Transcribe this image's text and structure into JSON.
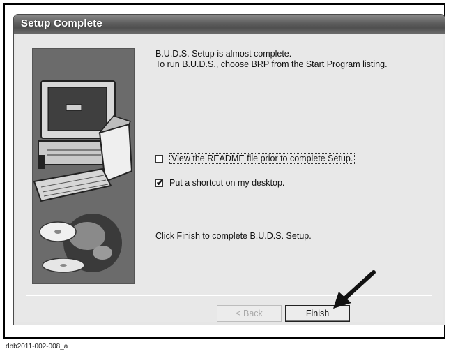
{
  "window": {
    "title": "Setup Complete"
  },
  "message": {
    "line1": "B.U.D.S. Setup is almost complete.",
    "line2": "To run B.U.D.S., choose BRP from the Start Program listing."
  },
  "options": [
    {
      "label": "View the README file prior to complete Setup.",
      "checked": false
    },
    {
      "label": "Put a shortcut on my desktop.",
      "checked": true
    }
  ],
  "check_mark": "✔",
  "finish_hint": "Click Finish to complete B.U.D.S. Setup.",
  "buttons": {
    "back": "< Back",
    "finish": "Finish"
  },
  "caption": "dbb2011-002-008_a",
  "icons": {
    "illustration": "computer-and-disc-illustration",
    "pointer": "arrow-icon"
  }
}
